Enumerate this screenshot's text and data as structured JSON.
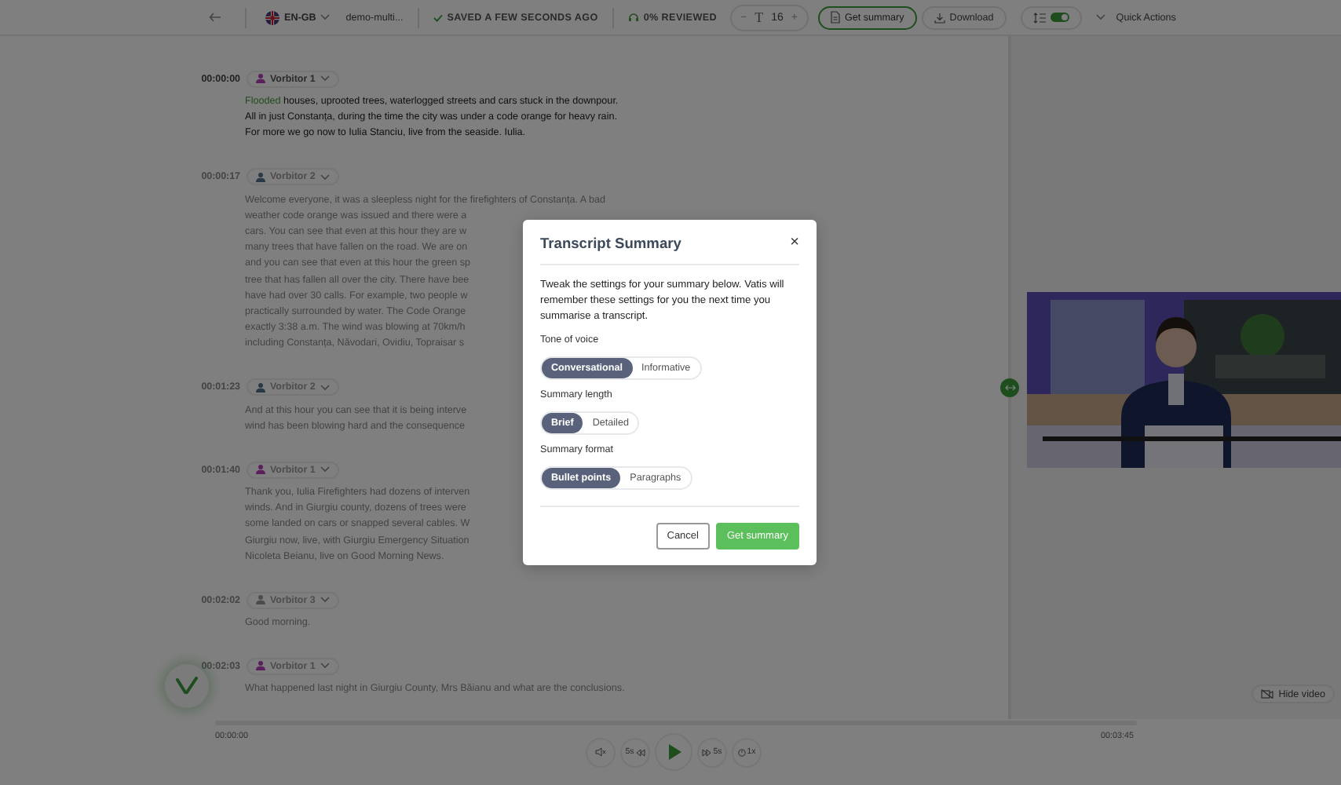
{
  "topbar": {
    "language": "EN-GB",
    "document": "demo-multi...",
    "saved_status": "SAVED A FEW SECONDS AGO",
    "review_status": "0% REVIEWED",
    "decrease": "−",
    "font_icon": "T",
    "font_size": "16",
    "increase": "+",
    "summary_button": "Get summary",
    "download_button": "Download",
    "line_toggle": {
      "on": true
    },
    "quick_actions": "Quick Actions"
  },
  "transcript": {
    "segments": [
      {
        "time": "00:00:00",
        "speaker": "Vorbitor 1",
        "color": "#5a205b",
        "active": true,
        "active_word": "Flooded",
        "lines": [
          "houses, uprooted trees, waterlogged streets and cars stuck in the downpour.",
          "All in just Constanța, during the time the city was under a code orange for heavy rain.",
          "For more we go now to Iulia Stanciu, live from the seaside. Iulia."
        ]
      },
      {
        "time": "00:00:17",
        "speaker": "Vorbitor 2",
        "color": "#283948",
        "active": false,
        "lines": [
          "Welcome everyone, it was a sleepless night for the firefighters of Constanța. A bad",
          "weather code orange was issued and there were a",
          "cars. You can see that even at this hour they are w",
          "many trees that have fallen on the road. We are on",
          "and you can see that even at this hour the green sp",
          "tree that has fallen all over the city. There have bee",
          "have had over 30 calls. For example, two people w",
          "practically surrounded by water. The Code Orange",
          "exactly 3:38 a.m. The wind was blowing at 70km/h",
          "including Constanța, Năvodari, Ovidiu, Topraisar s"
        ]
      },
      {
        "time": "00:01:23",
        "speaker": "Vorbitor 2",
        "color": "#283948",
        "active": false,
        "lines": [
          "And at this hour you can see that it is being interve",
          "wind has been blowing hard and the consequence"
        ]
      },
      {
        "time": "00:01:40",
        "speaker": "Vorbitor 1",
        "color": "#5a205b",
        "active": false,
        "lines": [
          "Thank you, Iulia Firefighters had dozens of interven",
          "winds. And in Giurgiu county, dozens of trees were",
          "some landed on cars or snapped several cables. W",
          "Giurgiu now, live, with Giurgiu Emergency Situation",
          "Nicoleta Beianu, live on Good Morning News."
        ]
      },
      {
        "time": "00:02:02",
        "speaker": "Vorbitor 3",
        "color": "#4d4d4d",
        "active": false,
        "lines": [
          "Good morning."
        ]
      },
      {
        "time": "00:02:03",
        "speaker": "Vorbitor 1",
        "color": "#5a205b",
        "active": false,
        "lines": [
          "What happened last night in Giurgiu County, Mrs Băianu and what are the conclusions."
        ]
      }
    ]
  },
  "media": {
    "hide_video": "Hide video"
  },
  "player": {
    "elapsed": "00:00:00",
    "duration": "00:03:45",
    "rewind": "5s",
    "forward": "5s",
    "speed": "1x"
  },
  "modal": {
    "title": "Transcript Summary",
    "close": "×",
    "description": "Tweak the settings for your summary below. Vatis will remember these settings for you the next time you summarise a transcript.",
    "groups": [
      {
        "label": "Tone of voice",
        "options": [
          {
            "label": "Conversational",
            "selected": true
          },
          {
            "label": "Informative",
            "selected": false
          }
        ]
      },
      {
        "label": "Summary length",
        "options": [
          {
            "label": "Brief",
            "selected": true
          },
          {
            "label": "Detailed",
            "selected": false
          }
        ]
      },
      {
        "label": "Summary format",
        "options": [
          {
            "label": "Bullet points",
            "selected": true
          },
          {
            "label": "Paragraphs",
            "selected": false
          }
        ]
      }
    ],
    "cancel": "Cancel",
    "submit": "Get summary"
  }
}
